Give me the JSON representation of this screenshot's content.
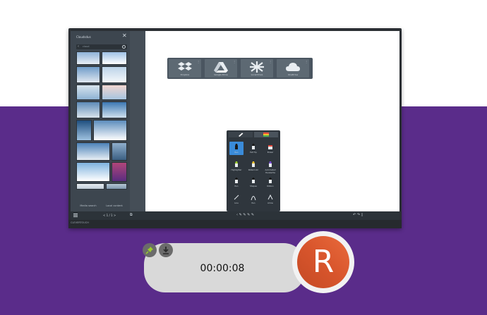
{
  "panel": {
    "title": "Cloudsdus",
    "search_placeholder": "cloud",
    "button_left": "Media search",
    "button_right": "Local content"
  },
  "cloud_services": [
    {
      "label": "Dropbox"
    },
    {
      "label": "Google Drive"
    },
    {
      "label": "Local Drive"
    },
    {
      "label": "OneDrive"
    }
  ],
  "tools": [
    {
      "label": "Pen"
    },
    {
      "label": "Felt Tip"
    },
    {
      "label": "Eraser"
    },
    {
      "label": "Highlighter"
    },
    {
      "label": "Watercolor"
    },
    {
      "label": "Automated Handwrite"
    },
    {
      "label": "Pen"
    },
    {
      "label": "Shapes"
    },
    {
      "label": "Ribbon"
    },
    {
      "label": "Line"
    },
    {
      "label": "Pen"
    },
    {
      "label": "Arrow"
    }
  ],
  "taskbar": {
    "nav_text": "< 1 / 1 >",
    "brand": "CLEVERTOUCH"
  },
  "recorder": {
    "timer": "00:00:08",
    "record_letter": "R"
  },
  "colors": {
    "purple_band": "#5a2c8a",
    "record": "#d8552c",
    "selected_tool": "#3a8bd9"
  }
}
